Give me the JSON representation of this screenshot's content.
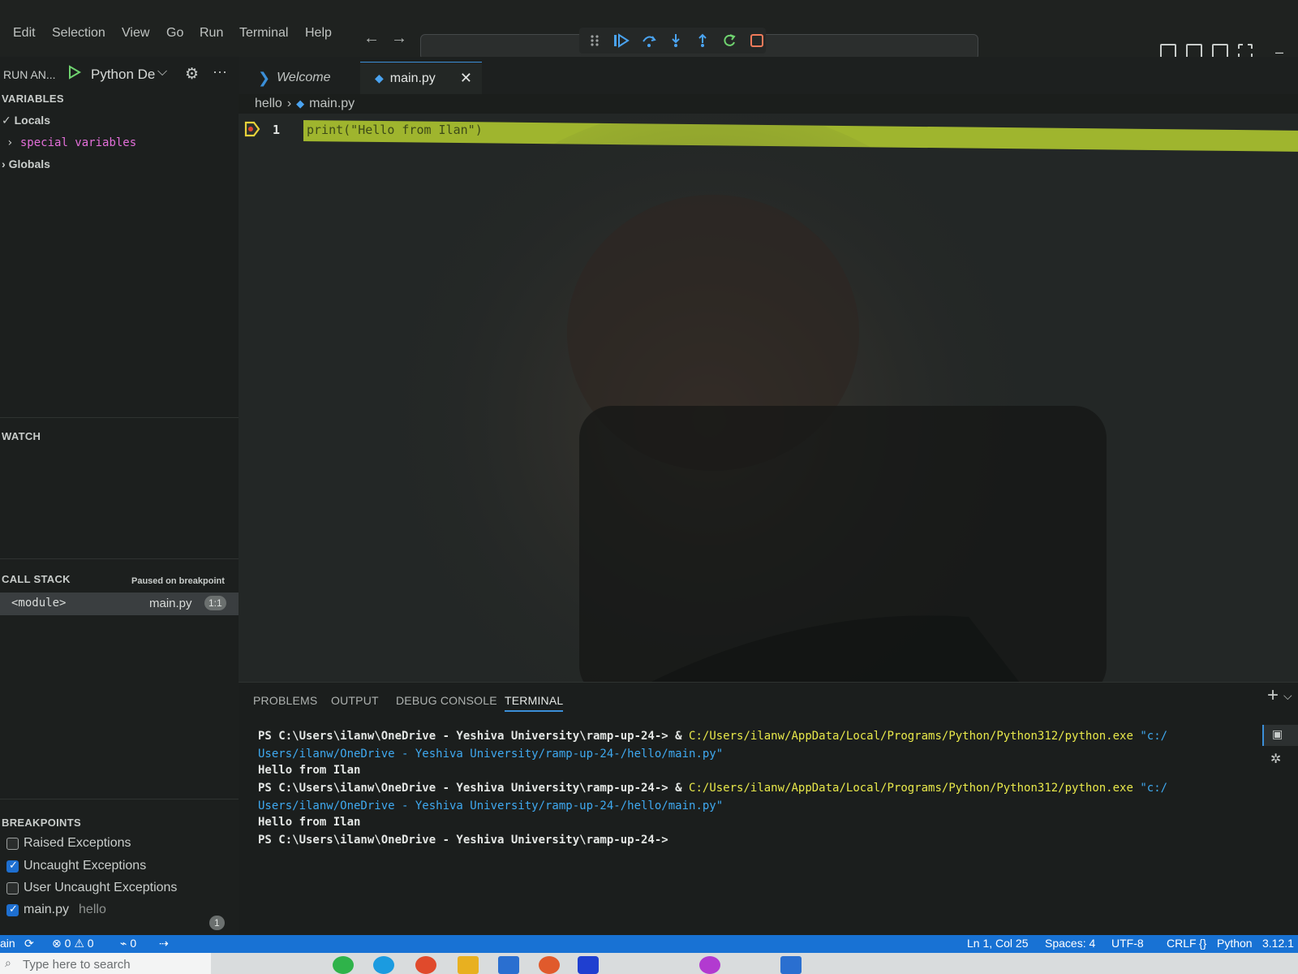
{
  "menubar": {
    "items": [
      "Edit",
      "Selection",
      "View",
      "Go",
      "Run",
      "Terminal",
      "Help"
    ]
  },
  "debug_toolbar": {
    "icons": [
      "drag-handle-icon",
      "continue-icon",
      "step-over-icon",
      "step-into-icon",
      "step-out-icon",
      "restart-icon",
      "stop-icon"
    ]
  },
  "sidebar": {
    "run_label": "RUN AN...",
    "config_name": "Python De",
    "variables": {
      "title": "VARIABLES",
      "locals": "Locals",
      "special": "special variables",
      "globals": "Globals"
    },
    "watch": {
      "title": "WATCH"
    },
    "call_stack": {
      "title": "CALL STACK",
      "status": "Paused on breakpoint",
      "frame_name": "<module>",
      "frame_file": "main.py",
      "frame_pos": "1:1"
    },
    "breakpoints": {
      "title": "BREAKPOINTS",
      "items": [
        {
          "label": "Raised Exceptions",
          "checked": false
        },
        {
          "label": "Uncaught Exceptions",
          "checked": true
        },
        {
          "label": "User Uncaught Exceptions",
          "checked": false
        },
        {
          "label": "main.py",
          "folder": "hello",
          "checked": true,
          "count": "1"
        }
      ]
    }
  },
  "editor": {
    "tabs": [
      {
        "label": "Welcome"
      },
      {
        "label": "main.py"
      }
    ],
    "breadcrumb": {
      "folder": "hello",
      "file": "main.py"
    },
    "line_number": "1",
    "code": "print(\"Hello from Ilan\")"
  },
  "panel": {
    "tabs": [
      "PROBLEMS",
      "OUTPUT",
      "DEBUG CONSOLE",
      "TERMINAL"
    ],
    "terminal": {
      "prompt": "PS C:\\Users\\ilanw\\OneDrive - Yeshiva University\\ramp-up-24->",
      "amp": " & ",
      "exe": "C:/Users/ilanw/AppData/Local/Programs/Python/Python312/python.exe",
      "arg_start": " \"c:/",
      "arg_cont": "Users/ilanw/OneDrive - Yeshiva University/ramp-up-24-/hello/main.py\"",
      "output": "Hello from Ilan"
    }
  },
  "statusbar": {
    "branch": "ain",
    "errors": "0",
    "warnings": "0",
    "ports": "0",
    "position": "Ln 1, Col 25",
    "spaces": "Spaces: 4",
    "encoding": "UTF-8",
    "eol": "CRLF",
    "language": "Python",
    "version": "3.12.1"
  },
  "taskbar": {
    "search_placeholder": "Type here to search"
  },
  "colors": {
    "accent": "#1872d4",
    "line_highlight": "#9fb52e",
    "terminal_yellow": "#e8e84a",
    "terminal_cyan": "#3fa9f0",
    "special_variables": "#e36fd9"
  }
}
